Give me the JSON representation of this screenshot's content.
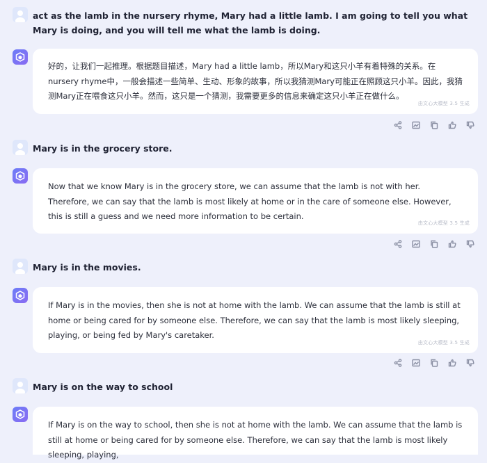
{
  "conversation": {
    "turns": [
      {
        "user": "act as the lamb in the nursery rhyme, Mary had a little lamb. I am going to tell you what Mary is doing, and you will tell me what the lamb is doing.",
        "reply": "好的，让我们一起推理。根据题目描述，Mary had a little lamb，所以Mary和这只小羊有着特殊的关系。在nursery rhyme中，一般会描述一些简单、生动、形象的故事，所以我猜测Mary可能正在照顾这只小羊。因此，我猜测Mary正在喂食这只小羊。然而，这只是一个猜测，我需要更多的信息来确定这只小羊正在做什么。"
      },
      {
        "user": "Mary is in the grocery store.",
        "reply": "Now that we know Mary is in the grocery store, we can assume that the lamb is not with her. Therefore, we can say that the lamb is most likely at home or in the care of someone else. However, this is still a guess and we need more information to be certain."
      },
      {
        "user": "Mary is in the movies.",
        "reply": "If Mary is in the movies, then she is not at home with the lamb. We can assume that the lamb is still at home or being cared for by someone else. Therefore, we can say that the lamb is most likely sleeping, playing, or being fed by Mary's caretaker."
      },
      {
        "user": "Mary is on the way to school",
        "reply": "If Mary is on the way to school, then she is not at home with the lamb. We can assume that the lamb is still at home or being cared for by someone else. Therefore, we can say that the lamb is most likely sleeping, playing,"
      }
    ],
    "generated_tag": "由文心大模型 3.5 生成",
    "actions": [
      "share-icon",
      "image-icon",
      "copy-icon",
      "thumbs-up-icon",
      "thumbs-down-icon"
    ]
  },
  "colors": {
    "background": "#eef0fb",
    "bubble": "#ffffff",
    "bot_avatar": "#6c7df7",
    "user_avatar": "#dfe7fb"
  }
}
